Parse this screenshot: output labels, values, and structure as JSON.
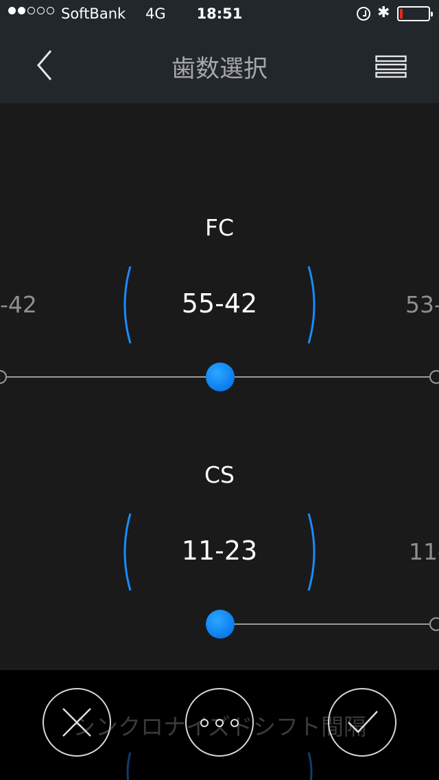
{
  "status": {
    "carrier": "SoftBank",
    "network": "4G",
    "time": "18:51",
    "signal_dots_filled": 2,
    "signal_dots_total": 5,
    "battery_level": 0.1,
    "battery_color": "#e32b20"
  },
  "nav": {
    "title": "歯数選択",
    "back_icon": "chevron-left-icon",
    "menu_icon": "menu-icon"
  },
  "fc": {
    "label": "FC",
    "value": "55-42",
    "prev_value": "-42",
    "next_value": "53-"
  },
  "cs": {
    "label": "CS",
    "value": "11-23",
    "next_value": "11-"
  },
  "bottom": {
    "sync_label": "シンクロナイズドシフト間隔",
    "cancel_icon": "close-icon",
    "more_icon": "more-icon",
    "confirm_icon": "check-icon"
  },
  "colors": {
    "accent": "#0a7bf0",
    "bracket": "#1a8cff",
    "header_bg": "#22272c",
    "content_bg": "#1a1a1a"
  }
}
